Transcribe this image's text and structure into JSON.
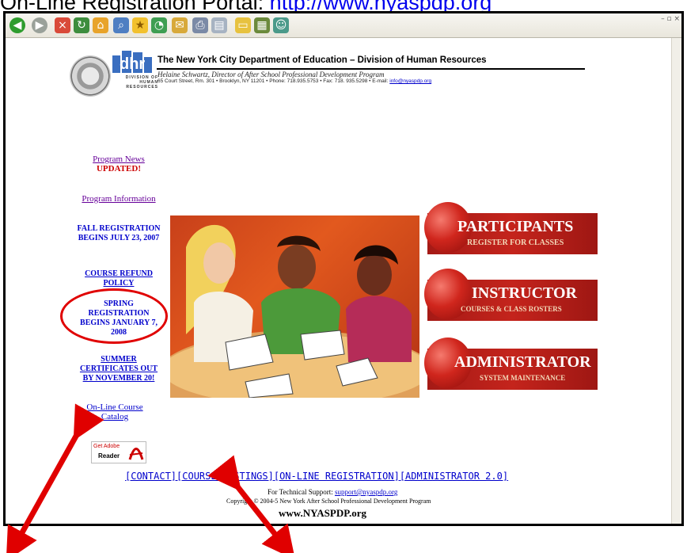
{
  "caption": {
    "prefix": "On-Line Registration Portal: ",
    "url": "http://www.nyaspdp.org"
  },
  "window": {
    "controls": "– ▫ ×"
  },
  "header": {
    "logo_text": "DIVISION OF HUMAN RESOURCES",
    "title": "The New York City Department of Education – Division of Human Resources",
    "director": "Helaine Schwartz, Director of After School Professional Development Program",
    "address": "65 Court Street, Rm. 301 • Brooklyn, NY 11201 • Phone: 718.935.5753 • Fax: 718. 935.5298 • E-mail: ",
    "email": "info@nyaspdp.org"
  },
  "nav": {
    "program_news": "Program News",
    "updated": "UPDATED!",
    "program_information": "Program Information",
    "fall_registration": "FALL REGISTRATION BEGINS JULY 23, 2007",
    "course_refund": "COURSE REFUND POLICY",
    "spring_registration": "SPRING REGISTRATION BEGINS JANUARY 7, 2008",
    "summer_certificates": "SUMMER CERTIFICATES OUT BY NOVEMBER 20!",
    "online_catalog": "On-Line Course Catalog",
    "acrobat_get": "Get Adobe",
    "acrobat_reader": "Reader"
  },
  "portals": [
    {
      "title": "PARTICIPANTS",
      "subtitle": "REGISTER FOR CLASSES"
    },
    {
      "title": "INSTRUCTOR",
      "subtitle": "COURSES & CLASS ROSTERS"
    },
    {
      "title": "ADMINISTRATOR",
      "subtitle": "SYSTEM MAINTENANCE"
    }
  ],
  "footer": {
    "contact": "[CONTACT]",
    "course_listings": "[COURSE LISTINGS]",
    "online_registration": "[ON-LINE REGISTRATION]",
    "administrator": "[ADMINISTRATOR 2.0]",
    "tech_support_label": "For Technical Support: ",
    "tech_support_email": "support@nyaspdp.org",
    "copyright": "Copyright © 2004-5 New York After School Professional Development Program",
    "site": "www.NYASPDP.org"
  },
  "colors": {
    "link_blue": "#0000cc",
    "visited_purple": "#660099",
    "alert_red": "#cc0000",
    "annotation_red": "#e00000",
    "apple_banner": "#b81f18"
  }
}
